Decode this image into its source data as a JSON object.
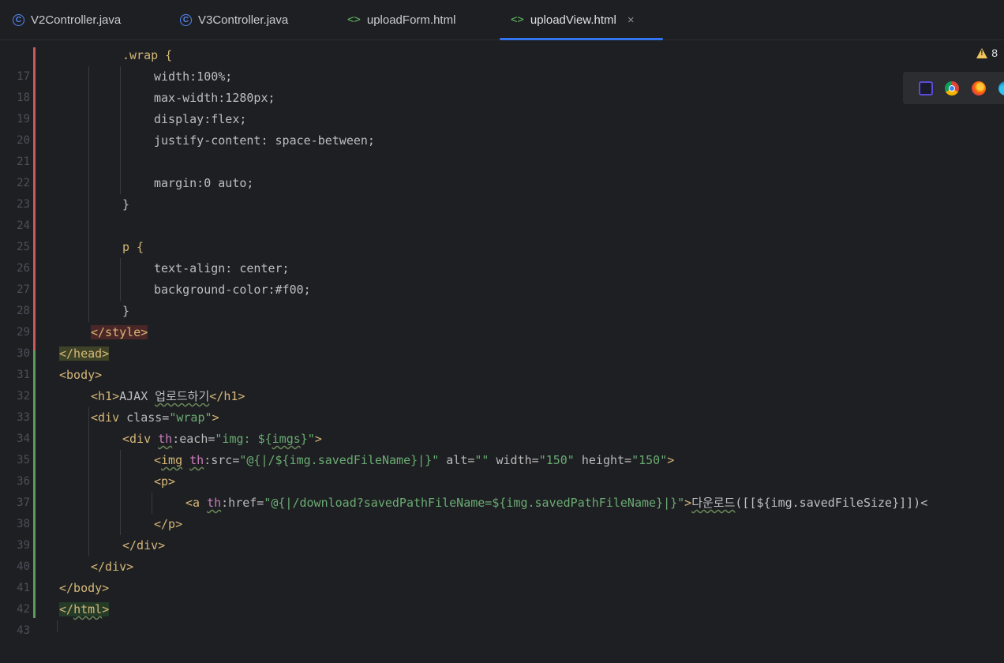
{
  "tabs": [
    {
      "label": "V2Controller.java",
      "type": "java",
      "active": false
    },
    {
      "label": "V3Controller.java",
      "type": "java",
      "active": false
    },
    {
      "label": "uploadForm.html",
      "type": "html",
      "active": false
    },
    {
      "label": "uploadView.html",
      "type": "html",
      "active": true,
      "closable": true
    }
  ],
  "icons": {
    "java": "C",
    "html": "<>",
    "close": "×"
  },
  "inspections": {
    "warning_count": "8"
  },
  "browser_icons": [
    "intellij-browser-icon",
    "chrome-icon",
    "firefox-icon",
    "edge-icon"
  ],
  "line_numbers": [
    "17",
    "18",
    "19",
    "20",
    "21",
    "22",
    "23",
    "24",
    "25",
    "26",
    "27",
    "28",
    "29",
    "30",
    "31",
    "32",
    "33",
    "34",
    "35",
    "36",
    "37",
    "38",
    "39",
    "40",
    "41",
    "42",
    "43"
  ],
  "code": {
    "l17": ".wrap {",
    "l18": "width:100%;",
    "l19": "max-width:1280px;",
    "l20": "display:flex;",
    "l21": "justify-content: space-between;",
    "l23": "margin:0 auto;",
    "l24": "}",
    "l26": "p {",
    "l27": "text-align: center;",
    "l28": "background-color:#f00;",
    "l29": "}",
    "l30": "</style>",
    "l31": "</head>",
    "l32": "<body>",
    "l33_open": "<h1>",
    "l33_text": "AJAX ",
    "l33_korean": "업로드하기",
    "l33_close": "</h1>",
    "l34_tag": "<div",
    "l34_attr": " class=",
    "l34_val": "\"wrap\"",
    "l34_end": ">",
    "l35_tag": "<div ",
    "l35_ns": "th",
    "l35_attr": ":each=",
    "l35_val1": "\"img: ${",
    "l35_val2": "imgs",
    "l35_val3": "}\"",
    "l35_end": ">",
    "l36_lt": "<",
    "l36_tag": "img",
    "l36_ns": "th",
    "l36_attr1": ":src=",
    "l36_val1": "\"@{|/${img.savedFileName}|}\"",
    "l36_attr2": " alt=",
    "l36_val2": "\"\"",
    "l36_attr3": " width=",
    "l36_val3": "\"150\"",
    "l36_attr4": " height=",
    "l36_val4": "\"150\"",
    "l36_end": ">",
    "l37": "<p>",
    "l38_tag": "<a ",
    "l38_ns": "th",
    "l38_attr": ":href=",
    "l38_val": "\"@{|/download?savedPathFileName=${img.savedPathFileName}|}\"",
    "l38_gt": ">",
    "l38_text1": "다운로드",
    "l38_text2": "([[${img.savedFileSize}]])<",
    "l39": "</p>",
    "l40": "</div>",
    "l41": "</div>",
    "l42": "</body>",
    "l43_open": "</",
    "l43_name": "html",
    "l43_close": ">"
  }
}
